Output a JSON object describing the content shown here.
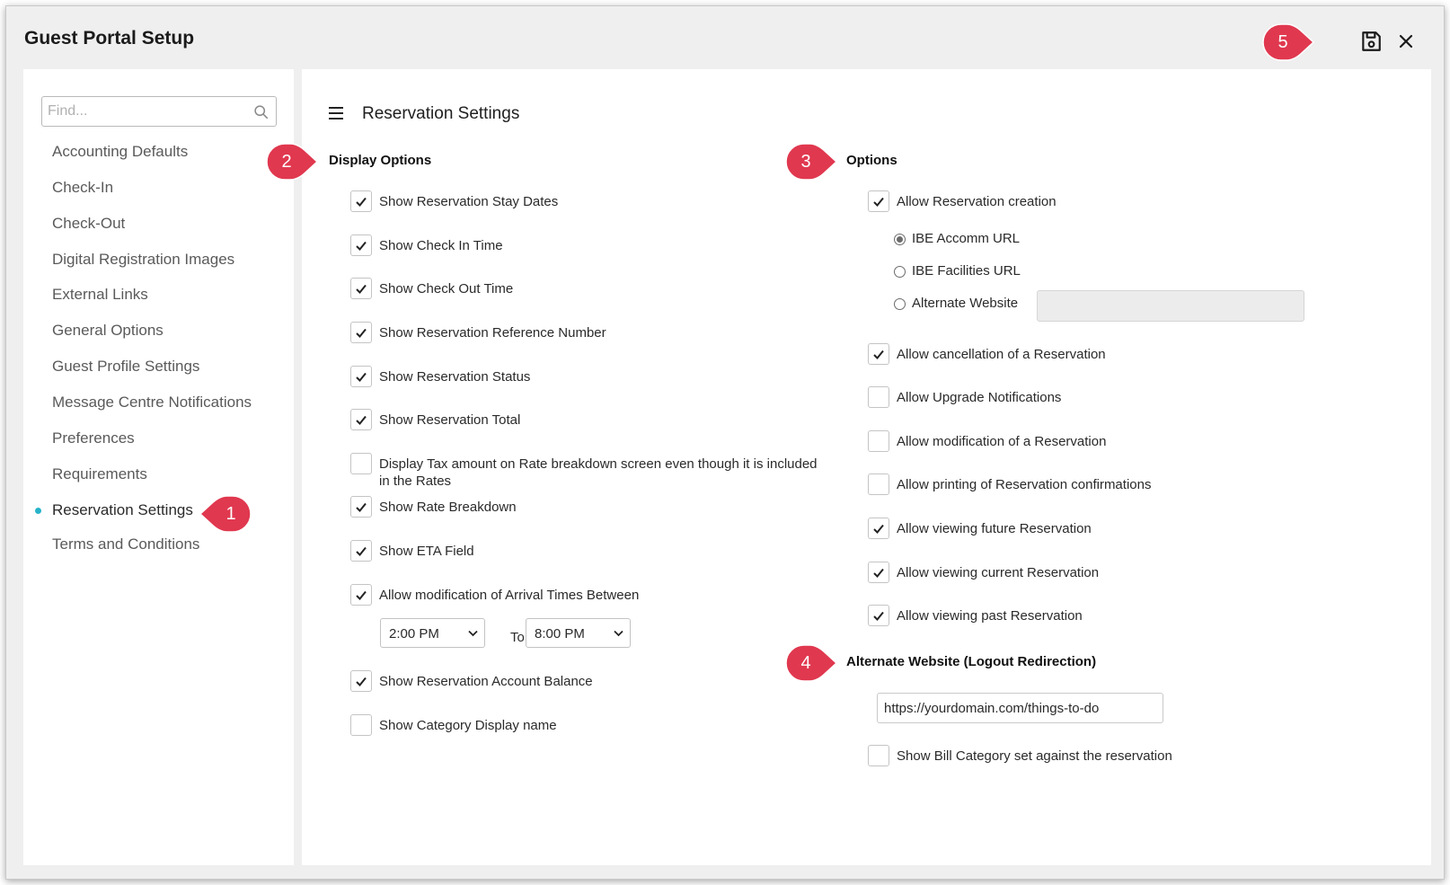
{
  "window": {
    "title": "Guest Portal Setup"
  },
  "header": {
    "save_icon": "save-icon",
    "close_icon": "close-icon"
  },
  "sidebar": {
    "search_placeholder": "Find...",
    "items": [
      {
        "label": "Accounting Defaults",
        "active": false
      },
      {
        "label": "Check-In",
        "active": false
      },
      {
        "label": "Check-Out",
        "active": false
      },
      {
        "label": "Digital Registration Images",
        "active": false
      },
      {
        "label": "External Links",
        "active": false
      },
      {
        "label": "General Options",
        "active": false
      },
      {
        "label": "Guest Profile Settings",
        "active": false
      },
      {
        "label": "Message Centre Notifications",
        "active": false
      },
      {
        "label": "Preferences",
        "active": false
      },
      {
        "label": "Requirements",
        "active": false
      },
      {
        "label": "Reservation Settings",
        "active": true
      },
      {
        "label": "Terms and Conditions",
        "active": false
      }
    ]
  },
  "main": {
    "title": "Reservation Settings",
    "display_options": {
      "heading": "Display Options",
      "items": [
        {
          "label": "Show Reservation Stay Dates",
          "checked": true
        },
        {
          "label": "Show Check In Time",
          "checked": true
        },
        {
          "label": "Show Check Out Time",
          "checked": true
        },
        {
          "label": "Show Reservation Reference Number",
          "checked": true
        },
        {
          "label": "Show Reservation Status",
          "checked": true
        },
        {
          "label": "Show Reservation Total",
          "checked": true
        },
        {
          "label": "Display Tax amount on Rate breakdown screen even though it is included in the Rates",
          "checked": false
        },
        {
          "label": "Show Rate Breakdown",
          "checked": true
        },
        {
          "label": "Show ETA Field",
          "checked": true
        },
        {
          "label": "Allow modification of Arrival Times Between",
          "checked": true
        },
        {
          "label": "Show Reservation Account Balance",
          "checked": true
        },
        {
          "label": "Show Category Display name",
          "checked": false
        }
      ],
      "arrival_from": "2:00 PM",
      "arrival_to_label": "To",
      "arrival_to": "8:00 PM"
    },
    "options": {
      "heading": "Options",
      "allow_creation": {
        "label": "Allow Reservation creation",
        "checked": true
      },
      "url_radios": [
        {
          "label": "IBE Accomm URL",
          "selected": true
        },
        {
          "label": "IBE Facilities URL",
          "selected": false
        },
        {
          "label": "Alternate Website",
          "selected": false
        }
      ],
      "items": [
        {
          "label": "Allow cancellation of a Reservation",
          "checked": true
        },
        {
          "label": "Allow Upgrade Notifications",
          "checked": false
        },
        {
          "label": "Allow modification of a Reservation",
          "checked": false
        },
        {
          "label": "Allow printing of Reservation confirmations",
          "checked": false
        },
        {
          "label": "Allow viewing future Reservation",
          "checked": true
        },
        {
          "label": "Allow viewing current Reservation",
          "checked": true
        },
        {
          "label": "Allow viewing past Reservation",
          "checked": true
        }
      ]
    },
    "logout_redirect": {
      "heading": "Alternate Website (Logout Redirection)",
      "url": "https://yourdomain.com/things-to-do",
      "bill_category": {
        "label": "Show Bill Category set against the reservation",
        "checked": false
      }
    }
  },
  "callouts": [
    "1",
    "2",
    "3",
    "4",
    "5"
  ],
  "colors": {
    "callout": "#e0384f",
    "active_dot": "#27b3c9",
    "panel_bg": "#ffffff",
    "window_bg": "#efefef"
  }
}
